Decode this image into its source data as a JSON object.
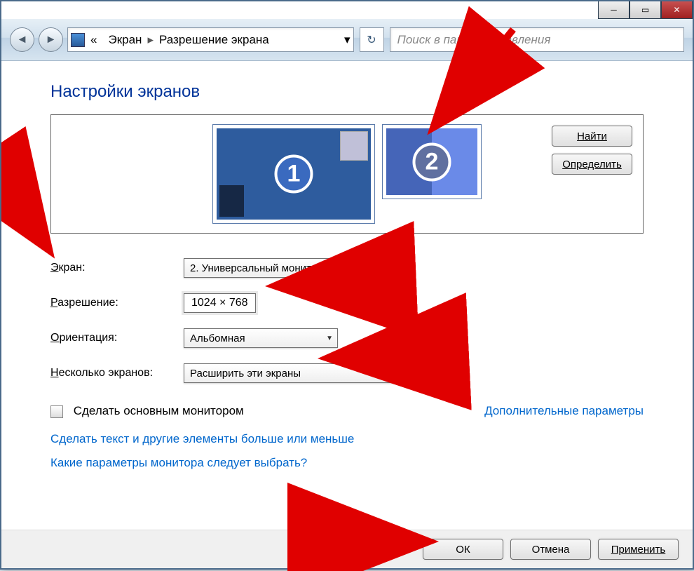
{
  "breadcrumb": {
    "item1": "Экран",
    "item2": "Разрешение экрана"
  },
  "search": {
    "placeholder": "Поиск в панели управления"
  },
  "heading": "Настройки экранов",
  "monitors": {
    "one": "1",
    "two": "2"
  },
  "buttons": {
    "find": "Найти",
    "identify": "Определить",
    "ok": "ОК",
    "cancel": "Отмена",
    "apply": "Применить"
  },
  "labels": {
    "display_pre": "Э",
    "display_rest": "кран:",
    "resolution_pre": "Р",
    "resolution_rest": "азрешение:",
    "orientation_pre": "О",
    "orientation_rest": "риентация:",
    "multi_pre": "Н",
    "multi_rest": "есколько экранов:"
  },
  "values": {
    "display": "2. Универсальный монитор не PnP",
    "resolution": "1024 × 768",
    "orientation": "Альбомная",
    "multi": "Расширить эти экраны"
  },
  "checkbox_label": "Сделать основным монитором",
  "links": {
    "advanced": "Дополнительные параметры",
    "text_size": "Сделать текст и другие элементы больше или меньше",
    "which": "Какие параметры монитора следует выбрать?"
  }
}
